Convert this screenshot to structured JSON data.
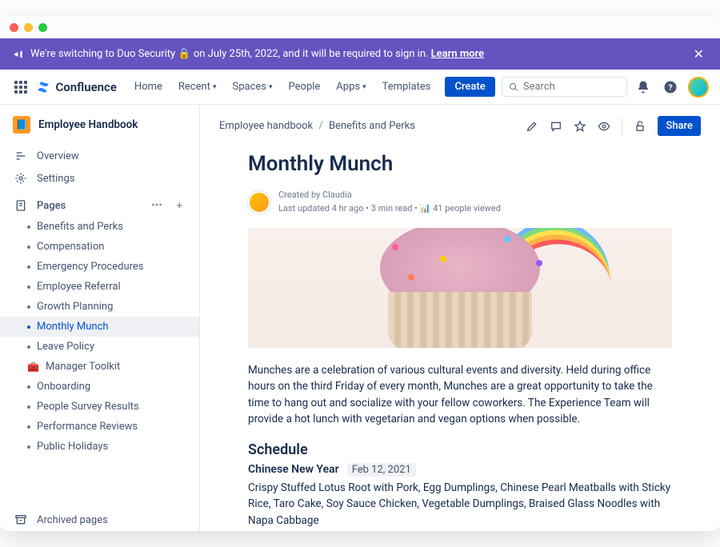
{
  "banner": {
    "prefix": "We're switching to Duo Security ",
    "suffix": " on July 25th, 2022, and it will be required to sign in. ",
    "link": "Learn more"
  },
  "nav": {
    "product": "Confluence",
    "items": [
      "Home",
      "Recent",
      "Spaces",
      "People",
      "Apps",
      "Templates"
    ],
    "create": "Create",
    "search_placeholder": "Search"
  },
  "sidebar": {
    "space_name": "Employee Handbook",
    "overview": "Overview",
    "settings": "Settings",
    "pages_label": "Pages",
    "pages": [
      {
        "label": "Benefits and Perks",
        "selected": false
      },
      {
        "label": "Compensation",
        "selected": false
      },
      {
        "label": "Emergency Procedures",
        "selected": false
      },
      {
        "label": "Employee Referral",
        "selected": false
      },
      {
        "label": "Growth Planning",
        "selected": false
      },
      {
        "label": "Monthly Munch",
        "selected": true
      },
      {
        "label": "Leave Policy",
        "selected": false
      },
      {
        "label": "Manager Toolkit",
        "selected": false,
        "emoji": "🧰"
      },
      {
        "label": "Onboarding",
        "selected": false
      },
      {
        "label": "People Survey Results",
        "selected": false
      },
      {
        "label": "Performance Reviews",
        "selected": false
      },
      {
        "label": "Public Holidays",
        "selected": false
      }
    ],
    "archived": "Archived pages"
  },
  "breadcrumb": {
    "items": [
      "Employee handbook",
      "Benefits and Perks"
    ]
  },
  "header_actions": {
    "share": "Share"
  },
  "article": {
    "title": "Monthly Munch",
    "created_by": "Created by Claudia",
    "meta": "Last updated 4 hr ago • 3 min read • ",
    "viewed": "41 people viewed",
    "intro": "Munches are a celebration of various cultural events and diversity. Held during office hours on the third Friday of every month, Munches are a great opportunity to take the time to hang out and socialize with your fellow coworkers. The Experience Team will provide a hot lunch with vegetarian and vegan options when possible.",
    "schedule_heading": "Schedule",
    "event": {
      "name": "Chinese New Year",
      "date": "Feb 12, 2021",
      "desc": "Crispy Stuffed Lotus Root with Pork, Egg Dumplings, Chinese Pearl Meatballs with Sticky Rice, Taro Cake, Soy Sauce Chicken, Vegetable Dumplings, Braised Glass Noodles with Napa Cabbage"
    }
  }
}
